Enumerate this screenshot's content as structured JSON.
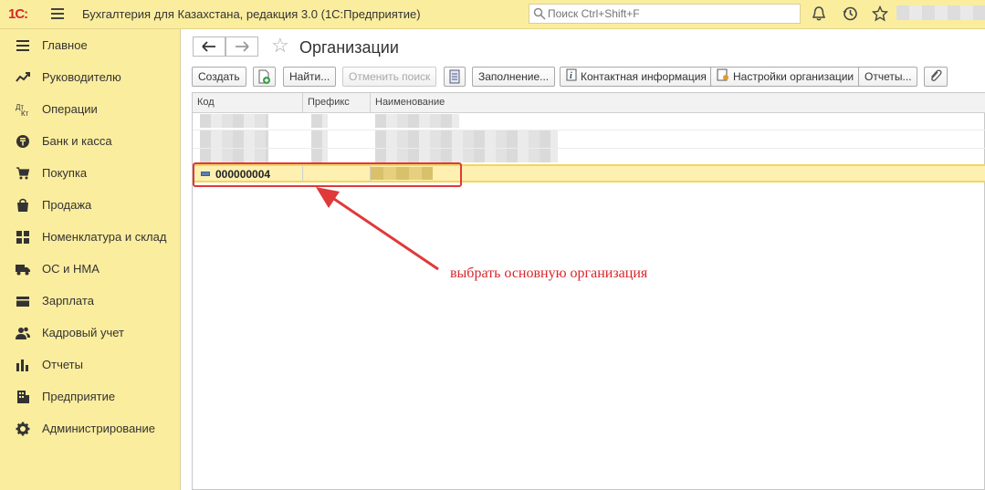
{
  "topbar": {
    "logo": "1С:",
    "app_title": "Бухгалтерия для Казахстана, редакция 3.0  (1С:Предприятие)",
    "search_placeholder": "Поиск Ctrl+Shift+F",
    "icons": [
      "bell-icon",
      "history-icon",
      "star-icon"
    ]
  },
  "sidebar": {
    "items": [
      {
        "label": "Главное",
        "icon": "menu-icon"
      },
      {
        "label": "Руководителю",
        "icon": "chart-line-icon"
      },
      {
        "label": "Операции",
        "icon": "dt-kt-icon"
      },
      {
        "label": "Банк и касса",
        "icon": "tenge-icon"
      },
      {
        "label": "Покупка",
        "icon": "cart-icon"
      },
      {
        "label": "Продажа",
        "icon": "bag-icon"
      },
      {
        "label": "Номенклатура и склад",
        "icon": "grid-icon"
      },
      {
        "label": "ОС и НМА",
        "icon": "truck-icon"
      },
      {
        "label": "Зарплата",
        "icon": "wallet-icon"
      },
      {
        "label": "Кадровый учет",
        "icon": "people-icon"
      },
      {
        "label": "Отчеты",
        "icon": "bar-chart-icon"
      },
      {
        "label": "Предприятие",
        "icon": "building-icon"
      },
      {
        "label": "Администрирование",
        "icon": "gear-icon"
      }
    ]
  },
  "form": {
    "title": "Организации"
  },
  "toolbar": {
    "create": "Создать",
    "find": "Найти...",
    "cancel_search": "Отменить поиск",
    "fill": "Заполнение...",
    "contact_info": "Контактная информация",
    "org_settings": "Настройки организации",
    "reports": "Отчеты..."
  },
  "table": {
    "columns": [
      "Код",
      "Префикс",
      "Наименование"
    ],
    "selected_row": {
      "code": "000000004"
    }
  },
  "annotation": "выбрать основную организация",
  "colors": {
    "accent": "#fbed9e",
    "annotation": "#d8262c",
    "selection": "#fdf0b0"
  }
}
